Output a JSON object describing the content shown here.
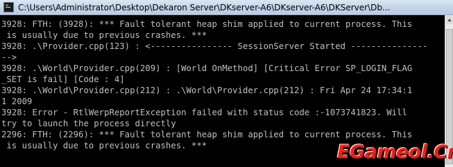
{
  "window": {
    "title": "C:\\Users\\Administrator\\Desktop\\Dekaron Server\\DKserver-A6\\DKserver-A6\\DKServer\\Db..."
  },
  "console": {
    "lines": [
      "3928: FTH: (3928): *** Fault tolerant heap shim applied to current process. This",
      " is usually due to previous crashes. ***",
      "3928: .\\Provider.cpp(123) : <---------------- SessionServer Started ---------------",
      "-->",
      "3928: .\\World\\Provider.cpp(209) : [World OnMethod] [Critical Error SP_LOGIN_FLAG",
      "_SET is fail] [Code : 4]",
      "3928: .\\World\\Provider.cpp(212) : .\\World\\Provider.cpp(212) : Fri Apr 24 17:34:1",
      "1 2009",
      "3928: Error - RtlWerpReportException failed with status code :-1073741823. Will",
      "try to launch the process directly",
      "2296: FTH: (2296): *** Fault tolerant heap shim applied to current process. This",
      " is usually due to previous crashes. ***"
    ]
  },
  "watermark": {
    "text": "EGameol.Cn"
  },
  "colors": {
    "console_background": "#000000",
    "console_text": "#c0c0c0",
    "watermark": "#e8231a"
  },
  "icons": {
    "window_icon": "console-window-icon",
    "scroll_up": "scroll-up-arrow-icon"
  }
}
